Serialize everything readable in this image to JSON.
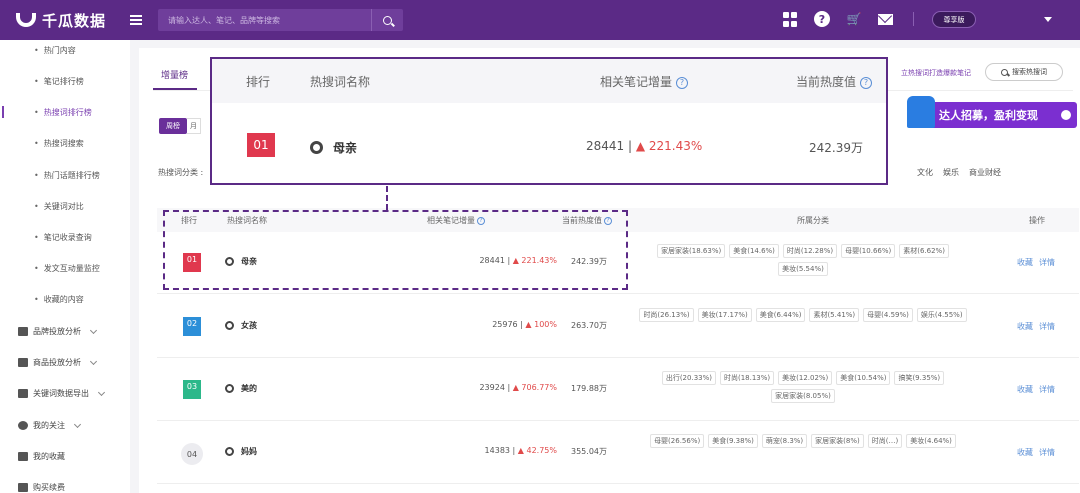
{
  "brand": {
    "name": "千瓜数据"
  },
  "search": {
    "placeholder": "请输入达人、笔记、品牌等搜索"
  },
  "user": {
    "vip_label": "尊享版"
  },
  "sidebar": {
    "sub_items": [
      {
        "label": "热门内容"
      },
      {
        "label": "笔记排行榜"
      },
      {
        "label": "热搜词排行榜"
      },
      {
        "label": "热搜词搜索"
      },
      {
        "label": "热门话题排行榜"
      },
      {
        "label": "关键词对比"
      },
      {
        "label": "笔记收录查询"
      },
      {
        "label": "发文互动量监控"
      },
      {
        "label": "收藏的内容"
      }
    ],
    "groups": [
      {
        "label": "品牌投放分析"
      },
      {
        "label": "商品投放分析"
      },
      {
        "label": "关键词数据导出"
      },
      {
        "label": "我的关注"
      },
      {
        "label": "我的收藏"
      },
      {
        "label": "购买续费"
      }
    ]
  },
  "main": {
    "tab_label": "增量榜",
    "period_week": "周榜",
    "period_month": "月",
    "category_label": "热搜词分类 :",
    "right_categories": [
      "文化",
      "娱乐",
      "商业财经"
    ],
    "right_link": "立热搜词打造爆款笔记",
    "hot_search_btn": "搜索热搜词",
    "promo_text": "达人招募，盈利变现"
  },
  "table": {
    "headers": {
      "rank": "排行",
      "word": "热搜词名称",
      "notes": "相关笔记增量",
      "heat": "当前热度值",
      "category": "所属分类",
      "ops": "操作"
    },
    "ops": {
      "collect": "收藏",
      "detail": "详情"
    },
    "rows": [
      {
        "rank": "01",
        "word": "母亲",
        "notes": "28441 |",
        "growth": "221.43%",
        "heat": "242.39万",
        "tags": [
          "家居家装(18.63%)",
          "美食(14.6%)",
          "时尚(12.28%)",
          "母婴(10.66%)",
          "素材(6.62%)",
          "美妆(5.54%)"
        ]
      },
      {
        "rank": "02",
        "word": "女孩",
        "notes": "25976 |",
        "growth": "100%",
        "heat": "263.70万",
        "tags": [
          "时尚(26.13%)",
          "美妆(17.17%)",
          "美食(6.44%)",
          "素材(5.41%)",
          "母婴(4.59%)",
          "娱乐(4.55%)"
        ]
      },
      {
        "rank": "03",
        "word": "美的",
        "notes": "23924 |",
        "growth": "706.77%",
        "heat": "179.88万",
        "tags": [
          "出行(20.33%)",
          "时尚(18.13%)",
          "美妆(12.02%)",
          "美食(10.54%)",
          "搞笑(9.35%)",
          "家居家装(8.05%)"
        ]
      },
      {
        "rank": "04",
        "word": "妈妈",
        "notes": "14383 |",
        "growth": "42.75%",
        "heat": "355.04万",
        "tags": [
          "母婴(26.56%)",
          "美食(9.38%)",
          "萌宠(8.3%)",
          "家居家装(8%)",
          "时尚(…)",
          "美妆(4.64%)"
        ]
      }
    ]
  },
  "callout": {
    "rank": "01",
    "word": "母亲",
    "notes": "28441 |",
    "growth": "221.43%",
    "heat": "242.39万"
  },
  "colors": {
    "brand": "#5b2a86",
    "rank1": "#e0384e",
    "rank2": "#2c8fd8",
    "rank3": "#2cb88a",
    "up": "#e04a4a",
    "link": "#5b8fd6"
  }
}
